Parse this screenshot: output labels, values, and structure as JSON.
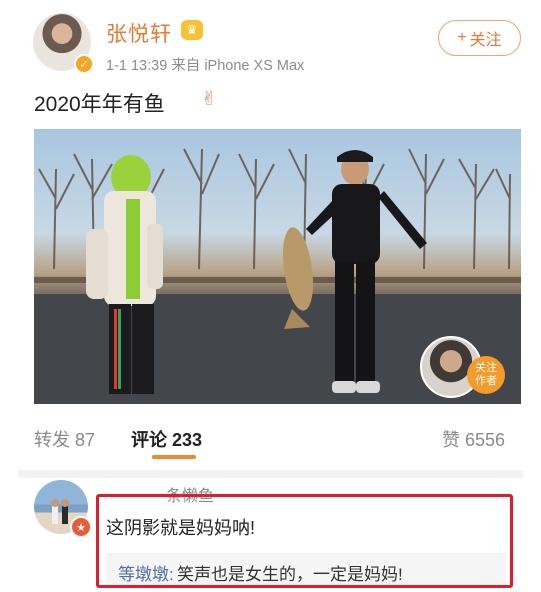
{
  "post": {
    "username": "张悦轩",
    "vip_icon": "crown-icon",
    "verified_icon": "v-badge-icon",
    "verified_mark": "✓",
    "time": "1-1 13:39",
    "source": "来自 iPhone XS Max",
    "follow_label": "关注",
    "follow_plus": "+",
    "text": "2020年年有鱼",
    "emoji": "✌",
    "photo": {
      "overlay_follow_label_1": "关注",
      "overlay_follow_label_2": "作者"
    }
  },
  "tabs": [
    {
      "label": "转发",
      "count": "87"
    },
    {
      "label": "评论",
      "count": "233"
    },
    {
      "label": "赞",
      "count": "6556"
    }
  ],
  "comment": {
    "username": "一一一条懒鱼",
    "badge": "★",
    "text": "这阴影就是妈妈呐!",
    "reply": {
      "username": "等墩墩",
      "separator": ":",
      "text": "笑声也是女生的，一定是妈妈!"
    }
  },
  "colors": {
    "accent": "#ea7a31",
    "highlight_box": "#e01e2b",
    "link": "#4e6ea6"
  }
}
